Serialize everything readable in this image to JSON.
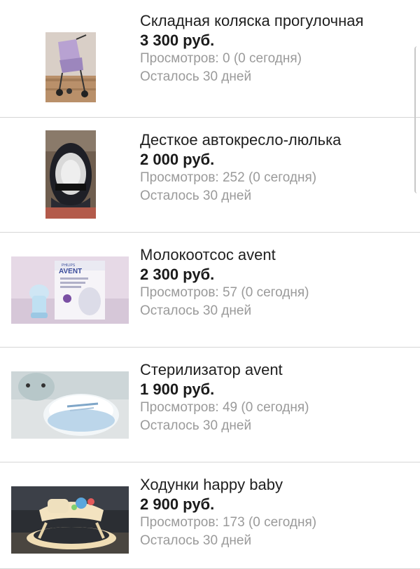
{
  "listings": [
    {
      "title": "Складная коляска прогулочная",
      "price": "3 300 руб.",
      "views": "Просмотров: 0 (0 сегодня)",
      "remaining": "Осталось 30 дней",
      "image": "stroller-photo"
    },
    {
      "title": "Десткое автокресло-люлька",
      "price": "2 000 руб.",
      "views": "Просмотров: 252 (0 сегодня)",
      "remaining": "Осталось 30 дней",
      "image": "car-seat-photo"
    },
    {
      "title": "Молокоотсос avent",
      "price": "2 300 руб.",
      "views": "Просмотров: 57 (0 сегодня)",
      "remaining": "Осталось 30 дней",
      "image": "breast-pump-photo"
    },
    {
      "title": "Стерилизатор avent",
      "price": "1 900 руб.",
      "views": "Просмотров: 49 (0 сегодня)",
      "remaining": "Осталось 30 дней",
      "image": "sterilizer-photo"
    },
    {
      "title": "Ходунки happy baby",
      "price": "2 900 руб.",
      "views": "Просмотров: 173 (0 сегодня)",
      "remaining": "Осталось 30 дней",
      "image": "baby-walker-photo"
    }
  ],
  "photo_labels": {
    "pump_brand": "PHILIPS",
    "pump_product": "AVENT"
  }
}
